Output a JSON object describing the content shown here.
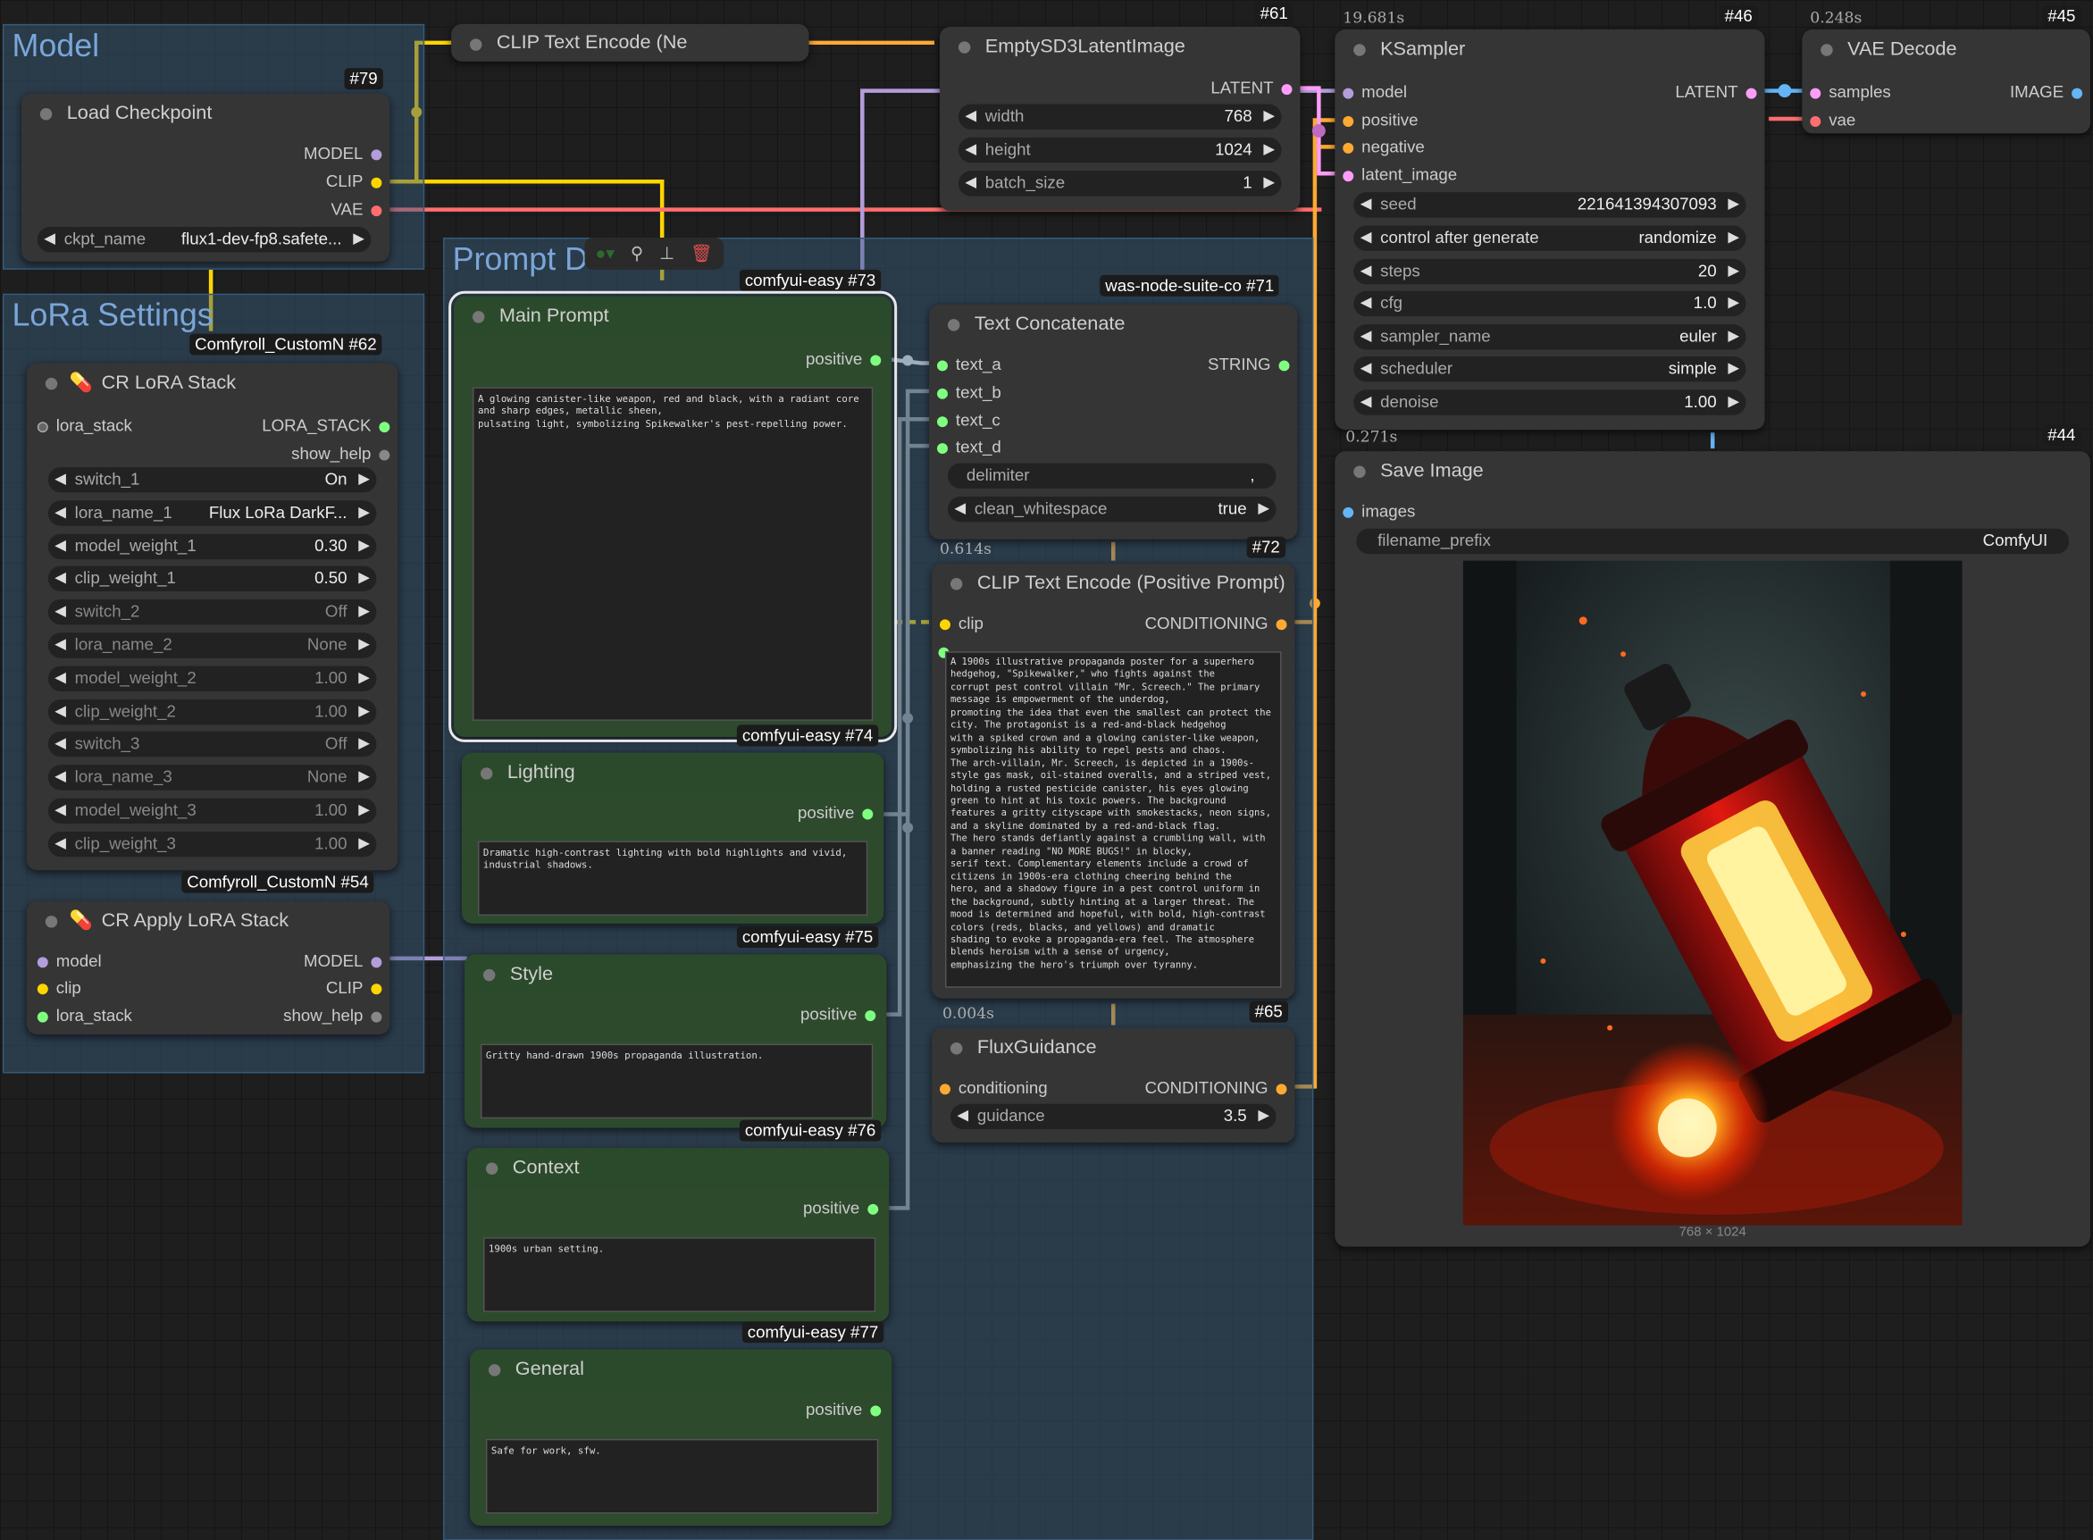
{
  "groups": {
    "model": "Model",
    "lora": "LoRa Settings",
    "prompt": "Prompt D"
  },
  "colors": {
    "model_wire": "#b39ddb",
    "clip_wire": "#ffd500",
    "vae_wire": "#ff6e6e",
    "latent_wire": "#ff9cf9",
    "conditioning_wire": "#ffa931",
    "string_wire": "#a1a1a1",
    "image_wire": "#64b5f6",
    "lora_wire": "#7fff7f"
  },
  "nodes": {
    "load_checkpoint": {
      "badge": "#79",
      "title": "Load Checkpoint",
      "outputs": [
        "MODEL",
        "CLIP",
        "VAE"
      ],
      "ckpt_label": "ckpt_name",
      "ckpt_value": "flux1-dev-fp8.safete..."
    },
    "clip_text_encode_neg": {
      "title": "CLIP Text Encode (Ne"
    },
    "empty_latent": {
      "badge": "#61",
      "title": "EmptySD3LatentImage",
      "output": "LATENT",
      "widgets": [
        {
          "label": "width",
          "value": "768"
        },
        {
          "label": "height",
          "value": "1024"
        },
        {
          "label": "batch_size",
          "value": "1"
        }
      ]
    },
    "ksampler": {
      "time": "19.681s",
      "badge": "#46",
      "title": "KSampler",
      "inputs": [
        "model",
        "positive",
        "negative",
        "latent_image"
      ],
      "output": "LATENT",
      "widgets": [
        {
          "label": "seed",
          "value": "221641394307093"
        },
        {
          "label": "control after generate",
          "value": "randomize"
        },
        {
          "label": "steps",
          "value": "20"
        },
        {
          "label": "cfg",
          "value": "1.0"
        },
        {
          "label": "sampler_name",
          "value": "euler"
        },
        {
          "label": "scheduler",
          "value": "simple"
        },
        {
          "label": "denoise",
          "value": "1.00"
        }
      ]
    },
    "vae_decode": {
      "time": "0.248s",
      "badge": "#45",
      "title": "VAE Decode",
      "inputs": [
        "samples",
        "vae"
      ],
      "output": "IMAGE"
    },
    "save_image": {
      "time": "0.271s",
      "badge": "#44",
      "title": "Save Image",
      "input": "images",
      "prefix_label": "filename_prefix",
      "prefix_value": "ComfyUI",
      "image_size": "768 × 1024"
    },
    "lora_stack": {
      "badge_label": "Comfyroll_CustomN",
      "badge": "#62",
      "title": "CR LoRA Stack",
      "input": "lora_stack",
      "outputs": [
        "LORA_STACK",
        "show_help"
      ],
      "widgets": [
        {
          "label": "switch_1",
          "value": "On"
        },
        {
          "label": "lora_name_1",
          "value": "Flux LoRa DarkF..."
        },
        {
          "label": "model_weight_1",
          "value": "0.30"
        },
        {
          "label": "clip_weight_1",
          "value": "0.50"
        },
        {
          "label": "switch_2",
          "value": "Off"
        },
        {
          "label": "lora_name_2",
          "value": "None"
        },
        {
          "label": "model_weight_2",
          "value": "1.00"
        },
        {
          "label": "clip_weight_2",
          "value": "1.00"
        },
        {
          "label": "switch_3",
          "value": "Off"
        },
        {
          "label": "lora_name_3",
          "value": "None"
        },
        {
          "label": "model_weight_3",
          "value": "1.00"
        },
        {
          "label": "clip_weight_3",
          "value": "1.00"
        }
      ]
    },
    "apply_lora": {
      "badge_label": "Comfyroll_CustomN",
      "badge": "#54",
      "title": "CR Apply LoRA Stack",
      "inputs": [
        "model",
        "clip",
        "lora_stack"
      ],
      "outputs": [
        "MODEL",
        "CLIP",
        "show_help"
      ]
    },
    "main_prompt": {
      "badge_label": "comfyui-easy",
      "badge": "#73",
      "title": "Main Prompt",
      "output": "positive",
      "text": "A glowing canister-like weapon, red and black, with a radiant core\nand sharp edges, metallic sheen,\npulsating light, symbolizing Spikewalker's pest-repelling power."
    },
    "lighting": {
      "badge_label": "comfyui-easy",
      "badge": "#74",
      "title": "Lighting",
      "output": "positive",
      "text": "Dramatic high-contrast lighting with bold highlights and vivid,\nindustrial shadows."
    },
    "style": {
      "badge_label": "comfyui-easy",
      "badge": "#75",
      "title": "Style",
      "output": "positive",
      "text": "Gritty hand-drawn 1900s propaganda illustration."
    },
    "context": {
      "badge_label": "comfyui-easy",
      "badge": "#76",
      "title": "Context",
      "output": "positive",
      "text": "1900s urban setting."
    },
    "general": {
      "badge_label": "comfyui-easy",
      "badge": "#77",
      "title": "General",
      "output": "positive",
      "text": "Safe for work, sfw."
    },
    "text_concat": {
      "badge_label": "was-node-suite-co",
      "badge": "#71",
      "title": "Text Concatenate",
      "inputs": [
        "text_a",
        "text_b",
        "text_c",
        "text_d"
      ],
      "output": "STRING",
      "delimiter_label": "delimiter",
      "delimiter_value": ",",
      "clean_label": "clean_whitespace",
      "clean_value": "true"
    },
    "clip_text_encode_pos": {
      "time": "0.614s",
      "badge": "#72",
      "title": "CLIP Text Encode (Positive Prompt)",
      "input": "clip",
      "output": "CONDITIONING",
      "text": "A 1900s illustrative propaganda poster for a superhero\nhedgehog, \"Spikewalker,\" who fights against the\ncorrupt pest control villain \"Mr. Screech.\" The primary\nmessage is empowerment of the underdog,\npromoting the idea that even the smallest can protect the\ncity. The protagonist is a red-and-black hedgehog\nwith a spiked crown and a glowing canister-like weapon,\nsymbolizing his ability to repel pests and chaos.\nThe arch-villain, Mr. Screech, is depicted in a 1900s-\nstyle gas mask, oil-stained overalls, and a striped vest,\nholding a rusted pesticide canister, his eyes glowing\ngreen to hint at his toxic powers. The background\nfeatures a gritty cityscape with smokestacks, neon signs,\nand a skyline dominated by a red-and-black flag.\nThe hero stands defiantly against a crumbling wall, with\na banner reading \"NO MORE BUGS!\" in blocky,\nserif text. Complementary elements include a crowd of\ncitizens in 1900s-era clothing cheering behind the\nhero, and a shadowy figure in a pest control uniform in\nthe background, subtly hinting at a larger threat. The\nmood is determined and hopeful, with bold, high-contrast\ncolors (reds, blacks, and yellows) and dramatic\nshading to evoke a propaganda-era feel. The atmosphere\nblends heroism with a sense of urgency,\nemphasizing the hero's triumph over tyranny."
    },
    "flux_guidance": {
      "time": "0.004s",
      "badge": "#65",
      "title": "FluxGuidance",
      "input": "conditioning",
      "output": "CONDITIONING",
      "guidance_label": "guidance",
      "guidance_value": "3.5"
    }
  }
}
